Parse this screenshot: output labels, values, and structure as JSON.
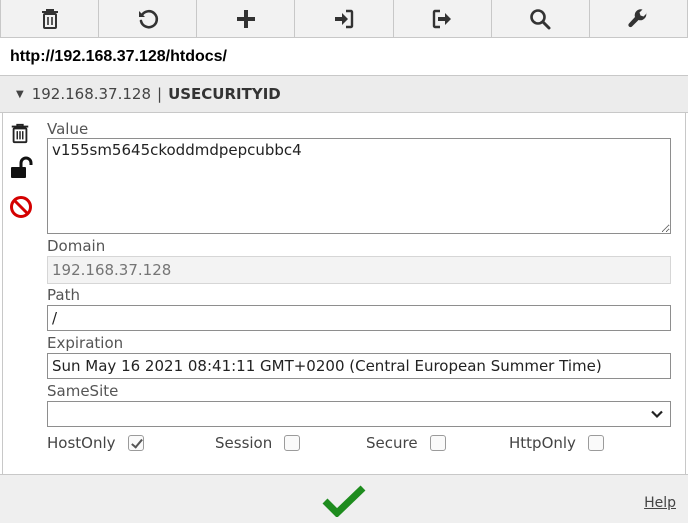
{
  "toolbar": {
    "buttons": [
      {
        "name": "delete-all",
        "icon": "trash-icon"
      },
      {
        "name": "reload",
        "icon": "refresh-icon"
      },
      {
        "name": "add",
        "icon": "plus-icon"
      },
      {
        "name": "import",
        "icon": "sign-in-icon"
      },
      {
        "name": "export",
        "icon": "sign-out-icon"
      },
      {
        "name": "search",
        "icon": "search-icon"
      },
      {
        "name": "options",
        "icon": "wrench-icon"
      }
    ]
  },
  "url": "http://192.168.37.128/htdocs/",
  "cookie": {
    "domain_header": "192.168.37.128",
    "separator": "|",
    "name": "USECURITYID",
    "value_label": "Value",
    "value": "v155sm5645ckoddmdpepcubbc4",
    "domain_label": "Domain",
    "domain_placeholder": "192.168.37.128",
    "path_label": "Path",
    "path": "/",
    "expiration_label": "Expiration",
    "expiration": "Sun May 16 2021 08:41:11 GMT+0200 (Central European Summer Time)",
    "samesite_label": "SameSite",
    "samesite": "",
    "flags": {
      "hostonly_label": "HostOnly",
      "hostonly": true,
      "session_label": "Session",
      "session": false,
      "secure_label": "Secure",
      "secure": false,
      "httponly_label": "HttpOnly",
      "httponly": false
    }
  },
  "side_icons": [
    "trash-icon",
    "unlock-icon",
    "block-icon"
  ],
  "footer": {
    "help": "Help",
    "save_icon": "checkmark-icon"
  },
  "colors": {
    "save_green": "#1e8c1e",
    "block_red": "#d40000"
  }
}
